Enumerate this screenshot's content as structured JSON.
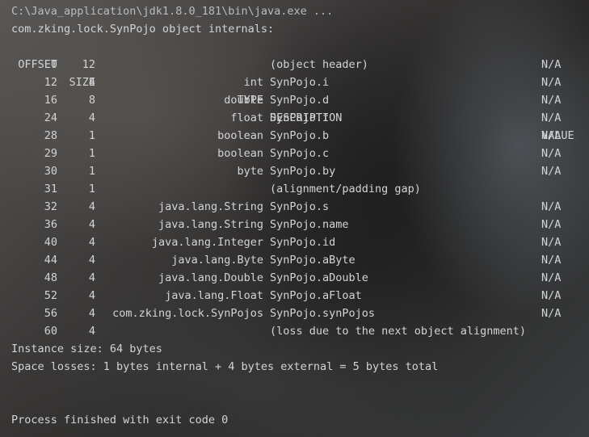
{
  "command_line": "C:\\Java_application\\jdk1.8.0_181\\bin\\java.exe ...",
  "object_title": "com.zking.lock.SynPojo object internals:",
  "header": {
    "offset": "OFFSET",
    "size": "SIZE",
    "type": "TYPE",
    "description": "DESCRIPTION",
    "value": "VALUE"
  },
  "rows": [
    {
      "offset": "0",
      "size": "12",
      "type": "",
      "description": "(object header)",
      "value": "N/A"
    },
    {
      "offset": "12",
      "size": "4",
      "type": "int",
      "description": "SynPojo.i",
      "value": "N/A"
    },
    {
      "offset": "16",
      "size": "8",
      "type": "double",
      "description": "SynPojo.d",
      "value": "N/A"
    },
    {
      "offset": "24",
      "size": "4",
      "type": "float",
      "description": "SynPojo.f",
      "value": "N/A"
    },
    {
      "offset": "28",
      "size": "1",
      "type": "boolean",
      "description": "SynPojo.b",
      "value": "N/A"
    },
    {
      "offset": "29",
      "size": "1",
      "type": "boolean",
      "description": "SynPojo.c",
      "value": "N/A"
    },
    {
      "offset": "30",
      "size": "1",
      "type": "byte",
      "description": "SynPojo.by",
      "value": "N/A"
    },
    {
      "offset": "31",
      "size": "1",
      "type": "",
      "description": "(alignment/padding gap)",
      "value": ""
    },
    {
      "offset": "32",
      "size": "4",
      "type": "java.lang.String",
      "description": "SynPojo.s",
      "value": "N/A"
    },
    {
      "offset": "36",
      "size": "4",
      "type": "java.lang.String",
      "description": "SynPojo.name",
      "value": "N/A"
    },
    {
      "offset": "40",
      "size": "4",
      "type": "java.lang.Integer",
      "description": "SynPojo.id",
      "value": "N/A"
    },
    {
      "offset": "44",
      "size": "4",
      "type": "java.lang.Byte",
      "description": "SynPojo.aByte",
      "value": "N/A"
    },
    {
      "offset": "48",
      "size": "4",
      "type": "java.lang.Double",
      "description": "SynPojo.aDouble",
      "value": "N/A"
    },
    {
      "offset": "52",
      "size": "4",
      "type": "java.lang.Float",
      "description": "SynPojo.aFloat",
      "value": "N/A"
    },
    {
      "offset": "56",
      "size": "4",
      "type": "com.zking.lock.SynPojos",
      "description": "SynPojo.synPojos",
      "value": "N/A"
    },
    {
      "offset": "60",
      "size": "4",
      "type": "",
      "description": "(loss due to the next object alignment)",
      "value": ""
    }
  ],
  "instance_size": "Instance size: 64 bytes",
  "space_losses": "Space losses: 1 bytes internal + 4 bytes external = 5 bytes total",
  "exit_message": "Process finished with exit code 0"
}
